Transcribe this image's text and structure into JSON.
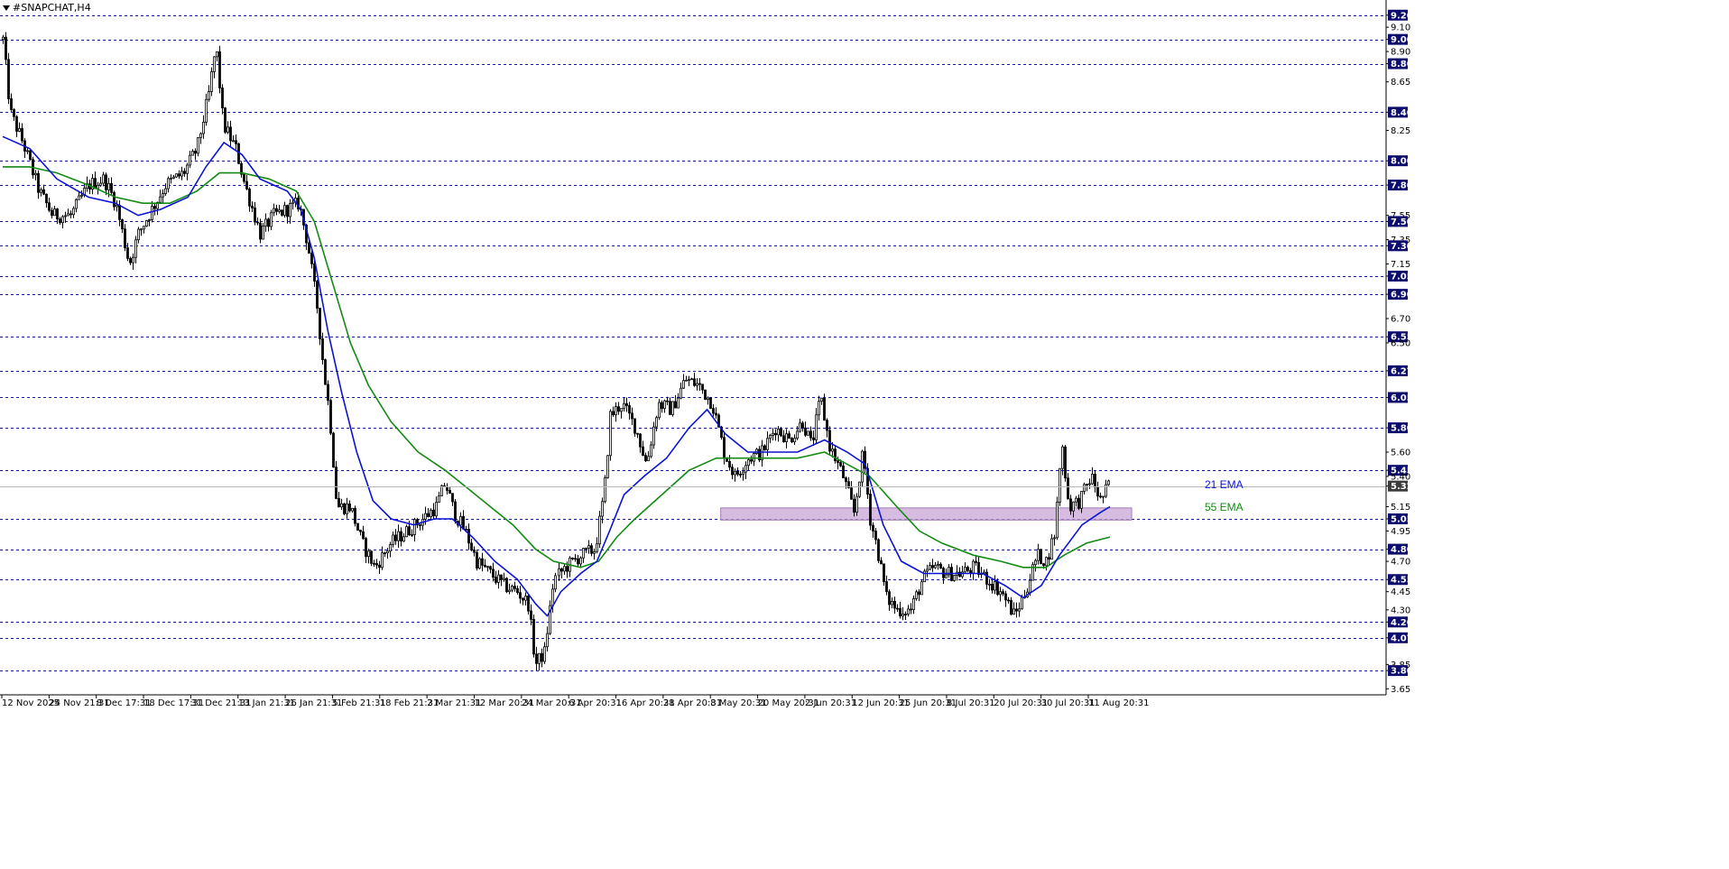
{
  "window": {
    "title": "#SNAPCHAT,H4"
  },
  "colors": {
    "ema21": "#0a14d2",
    "ema55": "#138a13",
    "level_line": "#1a1a8c",
    "zone_fill": "#c8a6d6",
    "price_box": "#0c0c6e",
    "current_price_box": "#3a3a3a"
  },
  "chart_data": {
    "type": "candlestick",
    "symbol": "#SNAPCHAT",
    "timeframe": "H4",
    "ylim": [
      3.6,
      9.28
    ],
    "y_ticks": [
      "9.20",
      "9.10",
      "9.00",
      "8.90",
      "8.80",
      "8.65",
      "8.40",
      "8.25",
      "8.00",
      "7.80",
      "7.55",
      "7.50",
      "7.35",
      "7.30",
      "7.15",
      "7.05",
      "6.90",
      "6.70",
      "6.55",
      "6.50",
      "6.27",
      "6.05",
      "5.80",
      "5.60",
      "5.45",
      "5.40",
      "5.32",
      "5.15",
      "5.05",
      "4.95",
      "4.80",
      "4.70",
      "4.55",
      "4.45",
      "4.30",
      "4.20",
      "4.07",
      "3.85",
      "3.80",
      "3.65"
    ],
    "x_labels": [
      "12 Nov 2025",
      "24 Nov 21:31",
      "8 Dec 17:31",
      "18 Dec 17:31",
      "31 Dec 21:31",
      "13 Jan 21:31",
      "26 Jan 21:31",
      "5 Feb 21:31",
      "18 Feb 21:31",
      "2 Mar 21:31",
      "12 Mar 20:31",
      "24 Mar 20:31",
      "6 Apr 20:31",
      "16 Apr 20:31",
      "28 Apr 20:31",
      "8 May 20:31",
      "20 May 20:31",
      "2 Jun 20:31",
      "12 Jun 20:31",
      "25 Jun 20:31",
      "8 Jul 20:31",
      "20 Jul 20:31",
      "30 Jul 20:31",
      "11 Aug 20:31"
    ],
    "horizontal_levels": [
      9.2,
      9.0,
      8.8,
      8.4,
      8.0,
      7.8,
      7.5,
      7.3,
      7.05,
      6.9,
      6.55,
      6.27,
      6.05,
      5.8,
      5.45,
      5.05,
      4.8,
      4.55,
      4.2,
      4.07,
      3.8
    ],
    "current_price": 5.32,
    "support_zone": {
      "low": 5.04,
      "high": 5.14
    },
    "ema_labels": [
      "21 EMA",
      "55 EMA"
    ],
    "price_path": [
      [
        0,
        9.0
      ],
      [
        8,
        8.4
      ],
      [
        22,
        8.15
      ],
      [
        40,
        7.75
      ],
      [
        55,
        7.55
      ],
      [
        75,
        7.55
      ],
      [
        95,
        7.8
      ],
      [
        112,
        7.85
      ],
      [
        125,
        7.65
      ],
      [
        140,
        7.15
      ],
      [
        150,
        7.4
      ],
      [
        165,
        7.6
      ],
      [
        180,
        7.8
      ],
      [
        200,
        7.9
      ],
      [
        215,
        8.1
      ],
      [
        228,
        8.55
      ],
      [
        236,
        8.95
      ],
      [
        244,
        8.3
      ],
      [
        258,
        8.1
      ],
      [
        268,
        7.8
      ],
      [
        285,
        7.4
      ],
      [
        300,
        7.55
      ],
      [
        315,
        7.6
      ],
      [
        328,
        7.65
      ],
      [
        338,
        7.3
      ],
      [
        348,
        6.8
      ],
      [
        355,
        6.3
      ],
      [
        362,
        5.9
      ],
      [
        370,
        5.15
      ],
      [
        385,
        5.15
      ],
      [
        398,
        4.85
      ],
      [
        412,
        4.65
      ],
      [
        430,
        4.85
      ],
      [
        448,
        4.95
      ],
      [
        465,
        5.05
      ],
      [
        480,
        5.15
      ],
      [
        490,
        5.35
      ],
      [
        500,
        5.1
      ],
      [
        512,
        4.95
      ],
      [
        525,
        4.7
      ],
      [
        540,
        4.6
      ],
      [
        555,
        4.5
      ],
      [
        570,
        4.45
      ],
      [
        582,
        4.35
      ],
      [
        590,
        3.85
      ],
      [
        600,
        3.95
      ],
      [
        610,
        4.55
      ],
      [
        622,
        4.65
      ],
      [
        640,
        4.75
      ],
      [
        655,
        4.8
      ],
      [
        665,
        5.25
      ],
      [
        672,
        5.9
      ],
      [
        685,
        6.0
      ],
      [
        700,
        5.8
      ],
      [
        712,
        5.5
      ],
      [
        725,
        6.0
      ],
      [
        740,
        5.95
      ],
      [
        755,
        6.2
      ],
      [
        770,
        6.15
      ],
      [
        785,
        6.0
      ],
      [
        798,
        5.6
      ],
      [
        810,
        5.4
      ],
      [
        825,
        5.55
      ],
      [
        840,
        5.6
      ],
      [
        855,
        5.8
      ],
      [
        870,
        5.7
      ],
      [
        885,
        5.85
      ],
      [
        895,
        5.65
      ],
      [
        905,
        6.05
      ],
      [
        915,
        5.65
      ],
      [
        930,
        5.4
      ],
      [
        942,
        5.1
      ],
      [
        952,
        5.6
      ],
      [
        960,
        5.05
      ],
      [
        968,
        4.8
      ],
      [
        978,
        4.4
      ],
      [
        990,
        4.3
      ],
      [
        1005,
        4.3
      ],
      [
        1018,
        4.55
      ],
      [
        1030,
        4.65
      ],
      [
        1045,
        4.6
      ],
      [
        1060,
        4.6
      ],
      [
        1075,
        4.65
      ],
      [
        1090,
        4.55
      ],
      [
        1105,
        4.45
      ],
      [
        1120,
        4.25
      ],
      [
        1132,
        4.45
      ],
      [
        1145,
        4.75
      ],
      [
        1155,
        4.7
      ],
      [
        1165,
        4.95
      ],
      [
        1172,
        5.7
      ],
      [
        1180,
        5.15
      ],
      [
        1192,
        5.2
      ],
      [
        1205,
        5.4
      ],
      [
        1215,
        5.2
      ],
      [
        1226,
        5.35
      ]
    ],
    "series": [
      {
        "name": "21 EMA",
        "points": [
          [
            0,
            8.2
          ],
          [
            30,
            8.1
          ],
          [
            60,
            7.85
          ],
          [
            95,
            7.7
          ],
          [
            125,
            7.65
          ],
          [
            150,
            7.55
          ],
          [
            175,
            7.6
          ],
          [
            205,
            7.7
          ],
          [
            225,
            7.95
          ],
          [
            245,
            8.15
          ],
          [
            265,
            8.05
          ],
          [
            285,
            7.85
          ],
          [
            315,
            7.75
          ],
          [
            330,
            7.6
          ],
          [
            345,
            7.2
          ],
          [
            360,
            6.6
          ],
          [
            375,
            6.1
          ],
          [
            392,
            5.6
          ],
          [
            410,
            5.2
          ],
          [
            430,
            5.05
          ],
          [
            455,
            5.0
          ],
          [
            478,
            5.05
          ],
          [
            498,
            5.05
          ],
          [
            520,
            4.9
          ],
          [
            545,
            4.7
          ],
          [
            570,
            4.55
          ],
          [
            590,
            4.35
          ],
          [
            603,
            4.25
          ],
          [
            618,
            4.45
          ],
          [
            640,
            4.6
          ],
          [
            658,
            4.7
          ],
          [
            672,
            4.95
          ],
          [
            688,
            5.25
          ],
          [
            710,
            5.4
          ],
          [
            735,
            5.55
          ],
          [
            760,
            5.8
          ],
          [
            780,
            5.95
          ],
          [
            800,
            5.75
          ],
          [
            825,
            5.6
          ],
          [
            850,
            5.6
          ],
          [
            880,
            5.6
          ],
          [
            910,
            5.7
          ],
          [
            935,
            5.6
          ],
          [
            955,
            5.5
          ],
          [
            975,
            5.0
          ],
          [
            995,
            4.7
          ],
          [
            1020,
            4.6
          ],
          [
            1050,
            4.6
          ],
          [
            1085,
            4.6
          ],
          [
            1110,
            4.5
          ],
          [
            1130,
            4.4
          ],
          [
            1150,
            4.5
          ],
          [
            1170,
            4.75
          ],
          [
            1195,
            5.0
          ],
          [
            1215,
            5.1
          ],
          [
            1226,
            5.15
          ]
        ]
      },
      {
        "name": "55 EMA",
        "points": [
          [
            0,
            7.95
          ],
          [
            30,
            7.95
          ],
          [
            60,
            7.9
          ],
          [
            95,
            7.8
          ],
          [
            125,
            7.7
          ],
          [
            155,
            7.65
          ],
          [
            185,
            7.65
          ],
          [
            215,
            7.75
          ],
          [
            240,
            7.9
          ],
          [
            265,
            7.9
          ],
          [
            295,
            7.85
          ],
          [
            325,
            7.75
          ],
          [
            345,
            7.5
          ],
          [
            365,
            7.0
          ],
          [
            385,
            6.5
          ],
          [
            405,
            6.15
          ],
          [
            430,
            5.85
          ],
          [
            460,
            5.6
          ],
          [
            490,
            5.45
          ],
          [
            515,
            5.3
          ],
          [
            540,
            5.15
          ],
          [
            565,
            5.0
          ],
          [
            590,
            4.8
          ],
          [
            610,
            4.7
          ],
          [
            640,
            4.65
          ],
          [
            660,
            4.7
          ],
          [
            680,
            4.9
          ],
          [
            700,
            5.05
          ],
          [
            730,
            5.25
          ],
          [
            760,
            5.45
          ],
          [
            790,
            5.55
          ],
          [
            820,
            5.55
          ],
          [
            850,
            5.55
          ],
          [
            880,
            5.55
          ],
          [
            910,
            5.6
          ],
          [
            935,
            5.5
          ],
          [
            960,
            5.4
          ],
          [
            990,
            5.15
          ],
          [
            1015,
            4.95
          ],
          [
            1040,
            4.85
          ],
          [
            1075,
            4.75
          ],
          [
            1105,
            4.7
          ],
          [
            1130,
            4.65
          ],
          [
            1155,
            4.65
          ],
          [
            1175,
            4.75
          ],
          [
            1200,
            4.85
          ],
          [
            1226,
            4.9
          ]
        ]
      }
    ]
  }
}
